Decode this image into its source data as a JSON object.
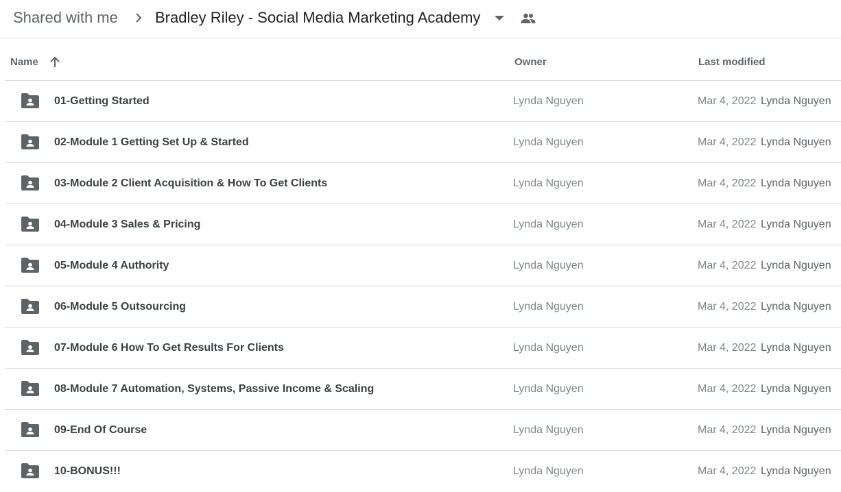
{
  "breadcrumb": {
    "parent": "Shared with me",
    "current": "Bradley Riley - Social Media Marketing Academy"
  },
  "icons": {
    "separator": "chevron-right-icon",
    "caret": "arrow-drop-down-icon",
    "shared": "people-icon",
    "sort": "arrow-upward-icon",
    "folder": "shared-folder-icon"
  },
  "columns": {
    "name": "Name",
    "owner": "Owner",
    "last_modified": "Last modified"
  },
  "colors": {
    "folder": "#5f6368",
    "divider": "#dadce0"
  },
  "files": [
    {
      "name": "01-Getting Started",
      "owner": "Lynda Nguyen",
      "date": "Mar 4, 2022",
      "modified_by": "Lynda Nguyen"
    },
    {
      "name": "02-Module 1 Getting Set Up & Started",
      "owner": "Lynda Nguyen",
      "date": "Mar 4, 2022",
      "modified_by": "Lynda Nguyen"
    },
    {
      "name": "03-Module 2 Client Acquisition & How To Get Clients",
      "owner": "Lynda Nguyen",
      "date": "Mar 4, 2022",
      "modified_by": "Lynda Nguyen"
    },
    {
      "name": "04-Module 3 Sales & Pricing",
      "owner": "Lynda Nguyen",
      "date": "Mar 4, 2022",
      "modified_by": "Lynda Nguyen"
    },
    {
      "name": "05-Module 4 Authority",
      "owner": "Lynda Nguyen",
      "date": "Mar 4, 2022",
      "modified_by": "Lynda Nguyen"
    },
    {
      "name": "06-Module 5 Outsourcing",
      "owner": "Lynda Nguyen",
      "date": "Mar 4, 2022",
      "modified_by": "Lynda Nguyen"
    },
    {
      "name": "07-Module 6 How To Get Results For Clients",
      "owner": "Lynda Nguyen",
      "date": "Mar 4, 2022",
      "modified_by": "Lynda Nguyen"
    },
    {
      "name": "08-Module 7 Automation, Systems, Passive Income & Scaling",
      "owner": "Lynda Nguyen",
      "date": "Mar 4, 2022",
      "modified_by": "Lynda Nguyen"
    },
    {
      "name": "09-End Of Course",
      "owner": "Lynda Nguyen",
      "date": "Mar 4, 2022",
      "modified_by": "Lynda Nguyen"
    },
    {
      "name": "10-BONUS!!!",
      "owner": "Lynda Nguyen",
      "date": "Mar 4, 2022",
      "modified_by": "Lynda Nguyen"
    }
  ]
}
